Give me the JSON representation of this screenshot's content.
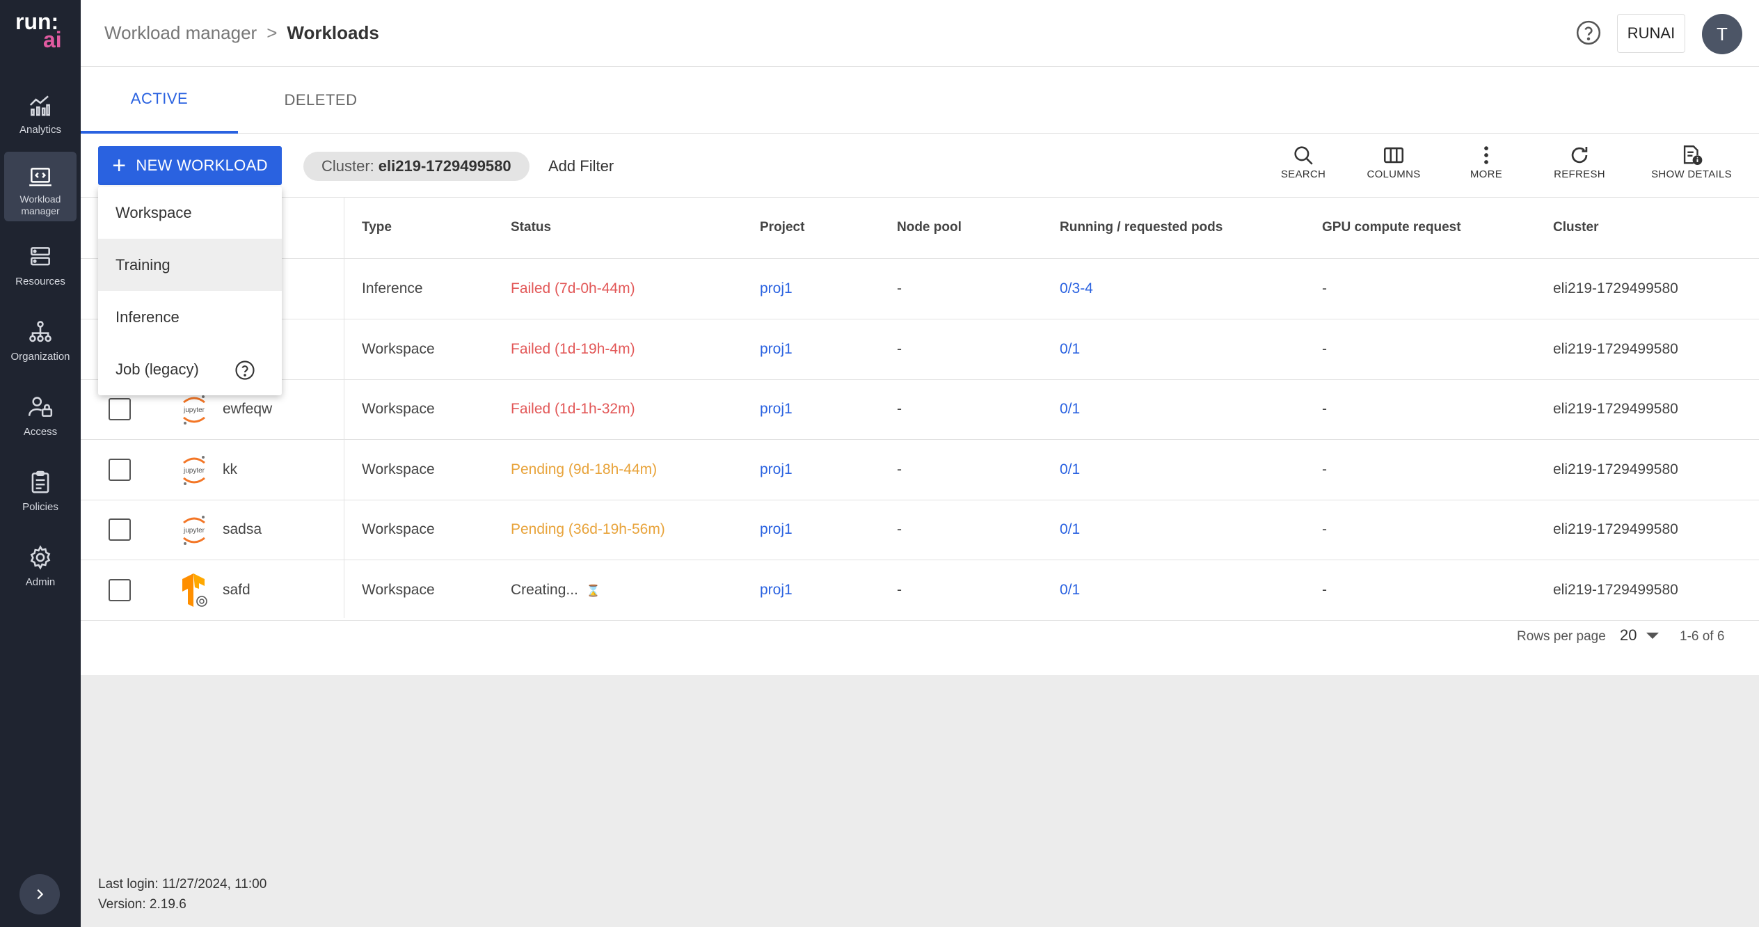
{
  "brand": {
    "line1": "run:",
    "line2": "ai"
  },
  "sidebar": {
    "items": [
      {
        "label": "Analytics",
        "icon": "analytics-icon"
      },
      {
        "label": "Workload manager",
        "icon": "workload-icon",
        "active": true
      },
      {
        "label": "Resources",
        "icon": "resources-icon"
      },
      {
        "label": "Organization",
        "icon": "organization-icon"
      },
      {
        "label": "Access",
        "icon": "access-icon"
      },
      {
        "label": "Policies",
        "icon": "policies-icon"
      },
      {
        "label": "Admin",
        "icon": "gear-icon"
      }
    ]
  },
  "header": {
    "breadcrumb_parent": "Workload manager",
    "breadcrumb_sep": ">",
    "breadcrumb_current": "Workloads",
    "tenant_button": "RUNAI",
    "avatar_initial": "T"
  },
  "tabs": [
    {
      "label": "ACTIVE",
      "active": true
    },
    {
      "label": "DELETED",
      "active": false
    }
  ],
  "toolbar": {
    "new_workload": "NEW WORKLOAD",
    "filter_key": "Cluster:",
    "filter_value": "eli219-1729499580",
    "add_filter": "Add Filter",
    "tools": [
      "SEARCH",
      "COLUMNS",
      "MORE",
      "REFRESH",
      "SHOW DETAILS"
    ]
  },
  "new_workload_menu": {
    "items": [
      "Workspace",
      "Training",
      "Inference",
      "Job (legacy)"
    ],
    "highlighted": "Training"
  },
  "table": {
    "columns": [
      "Type",
      "Status",
      "Project",
      "Node pool",
      "Running / requested pods",
      "GPU compute request",
      "Cluster"
    ],
    "rows": [
      {
        "name": "",
        "icon": "",
        "type": "Inference",
        "status": "Failed (7d-0h-44m)",
        "status_kind": "failed",
        "project": "proj1",
        "node_pool": "-",
        "pods": "0/3-4",
        "gpu": "-",
        "cluster": "eli219-1729499580"
      },
      {
        "name": "",
        "icon": "",
        "type": "Workspace",
        "status": "Failed (1d-19h-4m)",
        "status_kind": "failed",
        "project": "proj1",
        "node_pool": "-",
        "pods": "0/1",
        "gpu": "-",
        "cluster": "eli219-1729499580"
      },
      {
        "name": "ewfeqw",
        "icon": "jupyter-icon",
        "type": "Workspace",
        "status": "Failed (1d-1h-32m)",
        "status_kind": "failed",
        "project": "proj1",
        "node_pool": "-",
        "pods": "0/1",
        "gpu": "-",
        "cluster": "eli219-1729499580"
      },
      {
        "name": "kk",
        "icon": "jupyter-icon",
        "type": "Workspace",
        "status": "Pending (9d-18h-44m)",
        "status_kind": "pending",
        "project": "proj1",
        "node_pool": "-",
        "pods": "0/1",
        "gpu": "-",
        "cluster": "eli219-1729499580"
      },
      {
        "name": "sadsa",
        "icon": "jupyter-icon",
        "type": "Workspace",
        "status": "Pending (36d-19h-56m)",
        "status_kind": "pending",
        "project": "proj1",
        "node_pool": "-",
        "pods": "0/1",
        "gpu": "-",
        "cluster": "eli219-1729499580"
      },
      {
        "name": "safd",
        "icon": "tensorflow-icon",
        "type": "Workspace",
        "status": "Creating...",
        "status_kind": "creating",
        "project": "proj1",
        "node_pool": "-",
        "pods": "0/1",
        "gpu": "-",
        "cluster": "eli219-1729499580"
      }
    ]
  },
  "pagination": {
    "rows_per_page_label": "Rows per page",
    "rows_per_page": "20",
    "range": "1-6 of 6"
  },
  "footer": {
    "last_login": "Last login: 11/27/2024, 11:00",
    "version": "Version: 2.19.6"
  },
  "colors": {
    "accent": "#2a62e0",
    "sidebar": "#1f2430",
    "failed": "#e25757",
    "pending": "#e8a33a",
    "brand_ai": "#e05aa0"
  }
}
